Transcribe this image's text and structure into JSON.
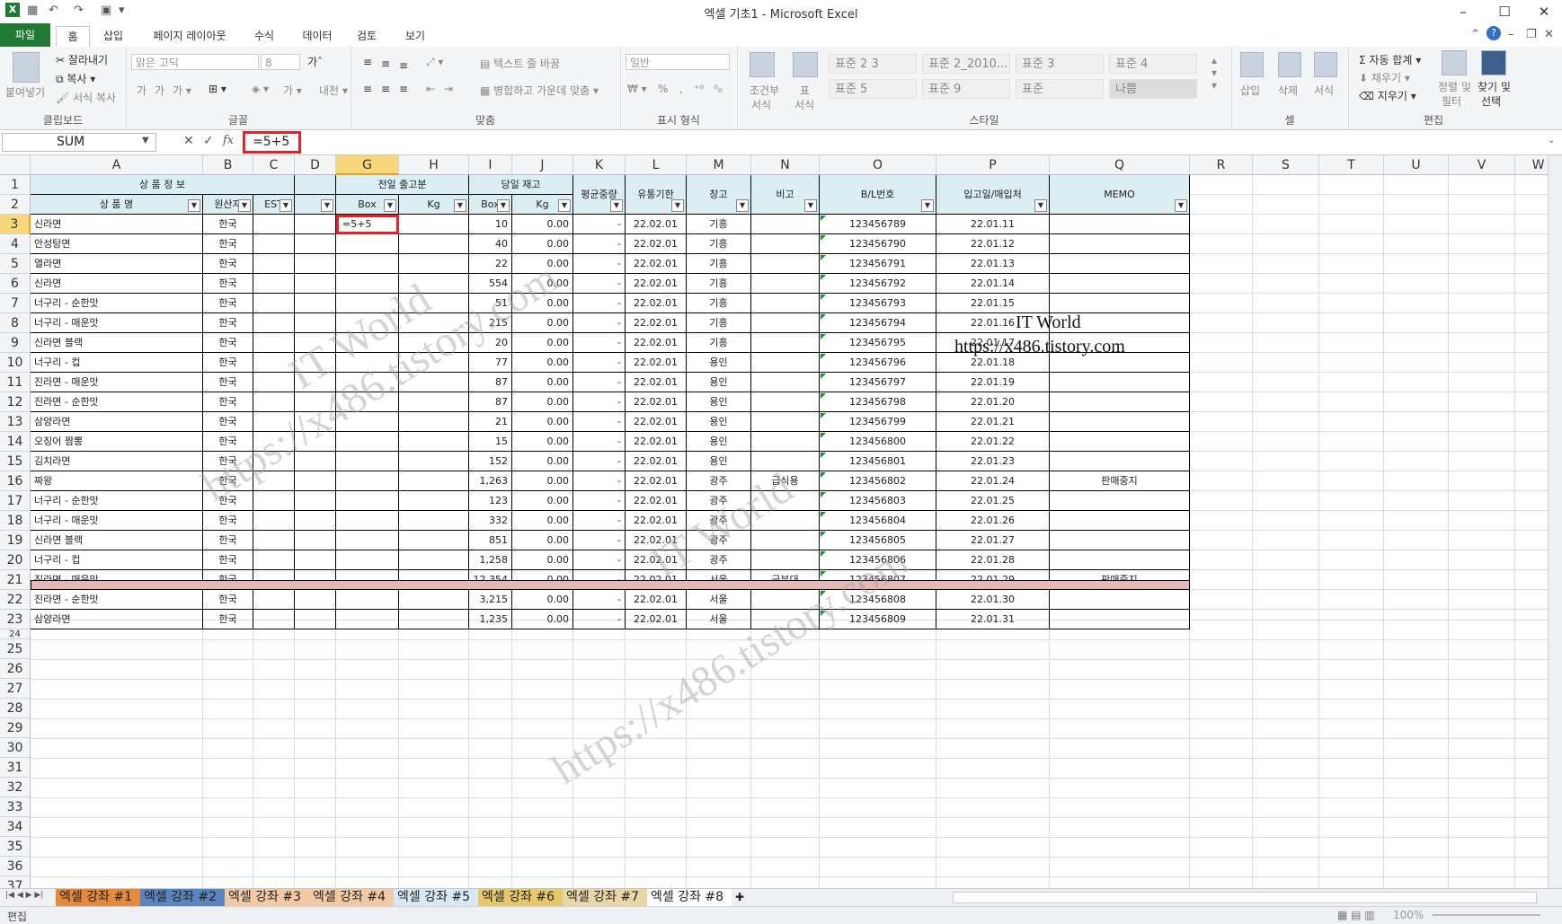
{
  "window": {
    "title": "엑셀 기초1  -  Microsoft Excel"
  },
  "ribbon_tabs": [
    "파일",
    "홈",
    "삽입",
    "페이지 레이아웃",
    "수식",
    "데이터",
    "검토",
    "보기"
  ],
  "ribbon": {
    "clipboard": {
      "paste": "붙여넣기",
      "cut": "잘라내기",
      "copy": "복사",
      "format_painter": "서식 복사",
      "label": "클립보드"
    },
    "font": {
      "name": "맑은 고딕",
      "size": "8",
      "label": "글꼴"
    },
    "align": {
      "wrap": "텍스트 줄 바꿈",
      "merge": "병합하고 가운데 맞춤",
      "label": "맞춤"
    },
    "number": {
      "format": "일반",
      "label": "표시 형식"
    },
    "styles": {
      "cond1": "조건부",
      "cond2": "서식",
      "table1": "표",
      "table2": "서식",
      "items": [
        "표준 2 3",
        "표준 2_2010...",
        "표준 3",
        "표준 4",
        "표준 5",
        "표준 9",
        "표준",
        "나쁨"
      ],
      "label": "스타일"
    },
    "cells": {
      "insert": "삽입",
      "delete": "삭제",
      "format": "서식",
      "label": "셀"
    },
    "edit": {
      "autosum": "자동 합계",
      "fill": "채우기",
      "clear": "지우기",
      "sort1": "정렬 및",
      "sort2": "필터",
      "find1": "찾기 및",
      "find2": "선택",
      "label": "편집"
    }
  },
  "formula_bar": {
    "name_box": "SUM",
    "formula": "=5+5"
  },
  "columns": [
    "A",
    "B",
    "C",
    "D",
    "G",
    "H",
    "I",
    "J",
    "K",
    "L",
    "M",
    "N",
    "O",
    "P",
    "Q",
    "R",
    "S",
    "T",
    "U",
    "V",
    "W"
  ],
  "table_header": {
    "row1": {
      "product_info": "상 품 정 보",
      "prev_out": "전일 출고분",
      "today_stock": "당일 재고",
      "avg_weight": "평균중량",
      "expiry": "유통기한",
      "warehouse": "창고",
      "note": "비고",
      "bl": "B/L번호",
      "import_date": "입고일/매입처",
      "memo": "MEMO"
    },
    "row2": {
      "name": "상 품 명",
      "origin": "원산지",
      "est": "EST",
      "box1": "Box",
      "kg1": "Kg",
      "box2": "Box",
      "kg2": "Kg"
    }
  },
  "rows": [
    {
      "name": "신라면",
      "origin": "한국",
      "g": "=5+5",
      "box": "10",
      "kg": "0.00",
      "avg": "-",
      "exp": "22.02.01",
      "wh": "기흥",
      "note": "",
      "bl": "123456789",
      "date": "22.01.11",
      "memo": ""
    },
    {
      "name": "안성탕면",
      "origin": "한국",
      "g": "",
      "box": "40",
      "kg": "0.00",
      "avg": "-",
      "exp": "22.02.01",
      "wh": "기흥",
      "note": "",
      "bl": "123456790",
      "date": "22.01.12",
      "memo": ""
    },
    {
      "name": "열라면",
      "origin": "한국",
      "g": "",
      "box": "22",
      "kg": "0.00",
      "avg": "-",
      "exp": "22.02.01",
      "wh": "기흥",
      "note": "",
      "bl": "123456791",
      "date": "22.01.13",
      "memo": ""
    },
    {
      "name": "신라면",
      "origin": "한국",
      "g": "",
      "box": "554",
      "kg": "0.00",
      "avg": "-",
      "exp": "22.02.01",
      "wh": "기흥",
      "note": "",
      "bl": "123456792",
      "date": "22.01.14",
      "memo": ""
    },
    {
      "name": "너구리 - 순한맛",
      "origin": "한국",
      "g": "",
      "box": "51",
      "kg": "0.00",
      "avg": "-",
      "exp": "22.02.01",
      "wh": "기흥",
      "note": "",
      "bl": "123456793",
      "date": "22.01.15",
      "memo": ""
    },
    {
      "name": "너구리 - 매운맛",
      "origin": "한국",
      "g": "",
      "box": "215",
      "kg": "0.00",
      "avg": "-",
      "exp": "22.02.01",
      "wh": "기흥",
      "note": "",
      "bl": "123456794",
      "date": "22.01.16",
      "memo": ""
    },
    {
      "name": "신라면 블랙",
      "origin": "한국",
      "g": "",
      "box": "20",
      "kg": "0.00",
      "avg": "-",
      "exp": "22.02.01",
      "wh": "기흥",
      "note": "",
      "bl": "123456795",
      "date": "22.01.17",
      "memo": ""
    },
    {
      "name": "너구리 - 컵",
      "origin": "한국",
      "g": "",
      "box": "77",
      "kg": "0.00",
      "avg": "-",
      "exp": "22.02.01",
      "wh": "용인",
      "note": "",
      "bl": "123456796",
      "date": "22.01.18",
      "memo": ""
    },
    {
      "name": "진라면 - 매운맛",
      "origin": "한국",
      "g": "",
      "box": "87",
      "kg": "0.00",
      "avg": "-",
      "exp": "22.02.01",
      "wh": "용인",
      "note": "",
      "bl": "123456797",
      "date": "22.01.19",
      "memo": ""
    },
    {
      "name": "진라면 - 순한맛",
      "origin": "한국",
      "g": "",
      "box": "87",
      "kg": "0.00",
      "avg": "-",
      "exp": "22.02.01",
      "wh": "용인",
      "note": "",
      "bl": "123456798",
      "date": "22.01.20",
      "memo": ""
    },
    {
      "name": "삼양라면",
      "origin": "한국",
      "g": "",
      "box": "21",
      "kg": "0.00",
      "avg": "-",
      "exp": "22.02.01",
      "wh": "용인",
      "note": "",
      "bl": "123456799",
      "date": "22.01.21",
      "memo": ""
    },
    {
      "name": "오징어 짬뽕",
      "origin": "한국",
      "g": "",
      "box": "15",
      "kg": "0.00",
      "avg": "-",
      "exp": "22.02.01",
      "wh": "용인",
      "note": "",
      "bl": "123456800",
      "date": "22.01.22",
      "memo": ""
    },
    {
      "name": "김치라면",
      "origin": "한국",
      "g": "",
      "box": "152",
      "kg": "0.00",
      "avg": "-",
      "exp": "22.02.01",
      "wh": "용인",
      "note": "",
      "bl": "123456801",
      "date": "22.01.23",
      "memo": ""
    },
    {
      "name": "짜왕",
      "origin": "한국",
      "g": "",
      "box": "1,263",
      "kg": "0.00",
      "avg": "-",
      "exp": "22.02.01",
      "wh": "광주",
      "note": "급식용",
      "bl": "123456802",
      "date": "22.01.24",
      "memo": "판매중지"
    },
    {
      "name": "너구리 - 순한맛",
      "origin": "한국",
      "g": "",
      "box": "123",
      "kg": "0.00",
      "avg": "-",
      "exp": "22.02.01",
      "wh": "광주",
      "note": "",
      "bl": "123456803",
      "date": "22.01.25",
      "memo": ""
    },
    {
      "name": "너구리 - 매운맛",
      "origin": "한국",
      "g": "",
      "box": "332",
      "kg": "0.00",
      "avg": "-",
      "exp": "22.02.01",
      "wh": "광주",
      "note": "",
      "bl": "123456804",
      "date": "22.01.26",
      "memo": ""
    },
    {
      "name": "신라면 블랙",
      "origin": "한국",
      "g": "",
      "box": "851",
      "kg": "0.00",
      "avg": "-",
      "exp": "22.02.01",
      "wh": "광주",
      "note": "",
      "bl": "123456805",
      "date": "22.01.27",
      "memo": ""
    },
    {
      "name": "너구리 - 컵",
      "origin": "한국",
      "g": "",
      "box": "1,258",
      "kg": "0.00",
      "avg": "-",
      "exp": "22.02.01",
      "wh": "광주",
      "note": "",
      "bl": "123456806",
      "date": "22.01.28",
      "memo": ""
    },
    {
      "name": "진라면 - 매운맛",
      "origin": "한국",
      "g": "",
      "box": "12,354",
      "kg": "0.00",
      "avg": "-",
      "exp": "22.02.01",
      "wh": "서울",
      "note": "군부대",
      "bl": "123456807",
      "date": "22.01.29",
      "memo": "판매중지"
    },
    {
      "name": "진라면 - 순한맛",
      "origin": "한국",
      "g": "",
      "box": "3,215",
      "kg": "0.00",
      "avg": "-",
      "exp": "22.02.01",
      "wh": "서울",
      "note": "",
      "bl": "123456808",
      "date": "22.01.30",
      "memo": ""
    },
    {
      "name": "삼양라면",
      "origin": "한국",
      "g": "",
      "box": "1,235",
      "kg": "0.00",
      "avg": "-",
      "exp": "22.02.01",
      "wh": "서울",
      "note": "",
      "bl": "123456809",
      "date": "22.01.31",
      "memo": ""
    }
  ],
  "row_numbers": [
    "1",
    "2",
    "3",
    "4",
    "5",
    "6",
    "7",
    "8",
    "9",
    "10",
    "11",
    "12",
    "13",
    "14",
    "15",
    "16",
    "17",
    "18",
    "19",
    "20",
    "21",
    "22",
    "23",
    "24",
    "25",
    "26",
    "27",
    "28",
    "29",
    "30",
    "31",
    "32",
    "33",
    "34",
    "35",
    "36",
    "37"
  ],
  "watermark": {
    "text1": "IT World",
    "text2": "https://x486.tistory.com"
  },
  "sheets": [
    {
      "name": "엑셀 강좌 #1",
      "color": "#e48a3a"
    },
    {
      "name": "엑셀 강좌 #2",
      "color": "#5a86c0"
    },
    {
      "name": "엑셀 강좌 #3",
      "color": "#f3c9a4"
    },
    {
      "name": "엑셀 강좌 #4",
      "color": "#f3c9a4"
    },
    {
      "name": "엑셀 강좌 #5",
      "color": "#d9e8f5"
    },
    {
      "name": "엑셀 강좌 #6",
      "color": "#e6c86a"
    },
    {
      "name": "엑셀 강좌 #7",
      "color": "#e8d6a4"
    },
    {
      "name": "엑셀 강좌 #8",
      "color": "#ffffff"
    }
  ],
  "status": {
    "mode": "편집",
    "zoom": "100%"
  }
}
